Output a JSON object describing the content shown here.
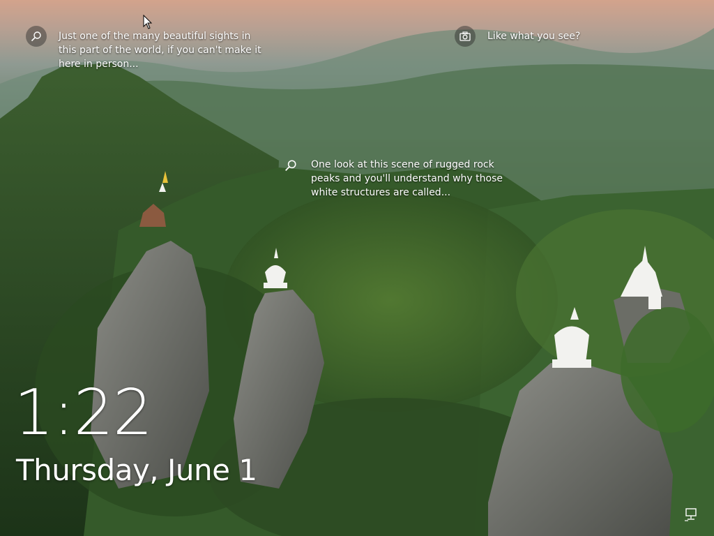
{
  "lockscreen": {
    "time": "1:22",
    "date": "Thursday, June 1"
  },
  "spotlight": {
    "hotspots": [
      {
        "icon": "magnifier-icon",
        "text": "Just one of the many beautiful sights in\nthis part of the world, if you can't make it\nhere in person..."
      },
      {
        "icon": "camera-icon",
        "text": "Like what you see?"
      },
      {
        "icon": "magnifier-icon",
        "text": "One look at this scene of rugged rock\npeaks and you'll understand why those\nwhite structures are called..."
      }
    ]
  },
  "status": {
    "icon": "network-icon"
  },
  "colors": {
    "sky_top": "#d9a48a",
    "haze": "#8a9a8f",
    "forest_dark": "#1f3a1c",
    "forest_mid": "#3e6a2c",
    "rock": "#7d7f79",
    "stupa": "#f2f2f0"
  }
}
